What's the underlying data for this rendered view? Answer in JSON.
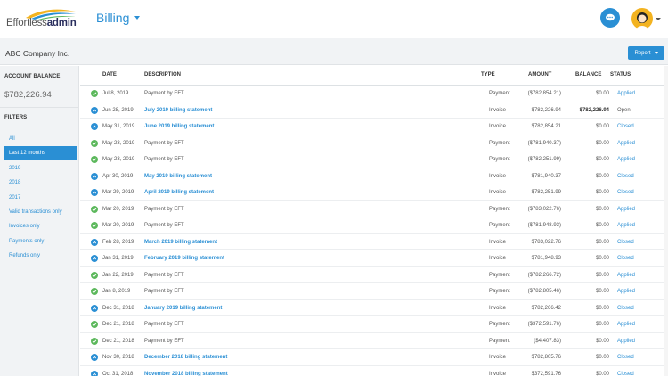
{
  "header": {
    "logo_light": "Effortless",
    "logo_bold": "admin",
    "app_name": "Billing"
  },
  "subheader": {
    "company": "ABC Company Inc.",
    "report_label": "Report"
  },
  "sidebar": {
    "balance_label": "ACCOUNT BALANCE",
    "balance_value": "$782,226.94",
    "filters_label": "FILTERS",
    "filters": [
      {
        "label": "All",
        "active": false
      },
      {
        "label": "Last 12 months",
        "active": true
      },
      {
        "label": "2019",
        "active": false
      },
      {
        "label": "2018",
        "active": false
      },
      {
        "label": "2017",
        "active": false
      },
      {
        "label": "Valid transactions only",
        "active": false
      },
      {
        "label": "Invoices only",
        "active": false
      },
      {
        "label": "Payments only",
        "active": false
      },
      {
        "label": "Refunds only",
        "active": false
      }
    ]
  },
  "table": {
    "columns": [
      "DATE",
      "DESCRIPTION",
      "TYPE",
      "AMOUNT",
      "BALANCE",
      "STATUS"
    ],
    "rows": [
      {
        "icon": "check-circle-icon",
        "date": "Jul 8, 2019",
        "description": "Payment by EFT",
        "link": false,
        "type": "Payment",
        "amount": "($782,854.21)",
        "balance": "$0.00",
        "balance_bold": false,
        "status": "Applied",
        "status_link": true
      },
      {
        "icon": "chevron-up-circle-icon",
        "date": "Jun 28, 2019",
        "description": "July 2019 billing statement",
        "link": true,
        "type": "Invoice",
        "amount": "$782,226.94",
        "balance": "$782,226.94",
        "balance_bold": true,
        "status": "Open",
        "status_link": false
      },
      {
        "icon": "chevron-up-circle-icon",
        "date": "May 31, 2019",
        "description": "June 2019 billing statement",
        "link": true,
        "type": "Invoice",
        "amount": "$782,854.21",
        "balance": "$0.00",
        "balance_bold": false,
        "status": "Closed",
        "status_link": true
      },
      {
        "icon": "check-circle-icon",
        "date": "May 23, 2019",
        "description": "Payment by EFT",
        "link": false,
        "type": "Payment",
        "amount": "($781,940.37)",
        "balance": "$0.00",
        "balance_bold": false,
        "status": "Applied",
        "status_link": true
      },
      {
        "icon": "check-circle-icon",
        "date": "May 23, 2019",
        "description": "Payment by EFT",
        "link": false,
        "type": "Payment",
        "amount": "($782,251.99)",
        "balance": "$0.00",
        "balance_bold": false,
        "status": "Applied",
        "status_link": true
      },
      {
        "icon": "chevron-up-circle-icon",
        "date": "Apr 30, 2019",
        "description": "May 2019 billing statement",
        "link": true,
        "type": "Invoice",
        "amount": "$781,940.37",
        "balance": "$0.00",
        "balance_bold": false,
        "status": "Closed",
        "status_link": true
      },
      {
        "icon": "chevron-up-circle-icon",
        "date": "Mar 29, 2019",
        "description": "April 2019 billing statement",
        "link": true,
        "type": "Invoice",
        "amount": "$782,251.99",
        "balance": "$0.00",
        "balance_bold": false,
        "status": "Closed",
        "status_link": true
      },
      {
        "icon": "check-circle-icon",
        "date": "Mar 20, 2019",
        "description": "Payment by EFT",
        "link": false,
        "type": "Payment",
        "amount": "($783,022.76)",
        "balance": "$0.00",
        "balance_bold": false,
        "status": "Applied",
        "status_link": true
      },
      {
        "icon": "check-circle-icon",
        "date": "Mar 20, 2019",
        "description": "Payment by EFT",
        "link": false,
        "type": "Payment",
        "amount": "($781,948.93)",
        "balance": "$0.00",
        "balance_bold": false,
        "status": "Applied",
        "status_link": true
      },
      {
        "icon": "chevron-up-circle-icon",
        "date": "Feb 28, 2019",
        "description": "March 2019 billing statement",
        "link": true,
        "type": "Invoice",
        "amount": "$783,022.76",
        "balance": "$0.00",
        "balance_bold": false,
        "status": "Closed",
        "status_link": true
      },
      {
        "icon": "chevron-up-circle-icon",
        "date": "Jan 31, 2019",
        "description": "February 2019 billing statement",
        "link": true,
        "type": "Invoice",
        "amount": "$781,948.93",
        "balance": "$0.00",
        "balance_bold": false,
        "status": "Closed",
        "status_link": true
      },
      {
        "icon": "check-circle-icon",
        "date": "Jan 22, 2019",
        "description": "Payment by EFT",
        "link": false,
        "type": "Payment",
        "amount": "($782,266.72)",
        "balance": "$0.00",
        "balance_bold": false,
        "status": "Applied",
        "status_link": true
      },
      {
        "icon": "check-circle-icon",
        "date": "Jan 8, 2019",
        "description": "Payment by EFT",
        "link": false,
        "type": "Payment",
        "amount": "($782,805.46)",
        "balance": "$0.00",
        "balance_bold": false,
        "status": "Applied",
        "status_link": true
      },
      {
        "icon": "chevron-up-circle-icon",
        "date": "Dec 31, 2018",
        "description": "January 2019 billing statement",
        "link": true,
        "type": "Invoice",
        "amount": "$782,266.42",
        "balance": "$0.00",
        "balance_bold": false,
        "status": "Closed",
        "status_link": true
      },
      {
        "icon": "check-circle-icon",
        "date": "Dec 21, 2018",
        "description": "Payment by EFT",
        "link": false,
        "type": "Payment",
        "amount": "($372,591.76)",
        "balance": "$0.00",
        "balance_bold": false,
        "status": "Applied",
        "status_link": true
      },
      {
        "icon": "check-circle-icon",
        "date": "Dec 21, 2018",
        "description": "Payment by EFT",
        "link": false,
        "type": "Payment",
        "amount": "($4,407.83)",
        "balance": "$0.00",
        "balance_bold": false,
        "status": "Applied",
        "status_link": true
      },
      {
        "icon": "chevron-up-circle-icon",
        "date": "Nov 30, 2018",
        "description": "December 2018 billing statement",
        "link": true,
        "type": "Invoice",
        "amount": "$782,805.76",
        "balance": "$0.00",
        "balance_bold": false,
        "status": "Closed",
        "status_link": true
      },
      {
        "icon": "chevron-up-circle-icon",
        "date": "Oct 31, 2018",
        "description": "November 2018 billing statement",
        "link": true,
        "type": "Invoice",
        "amount": "$372,591.76",
        "balance": "$0.00",
        "balance_bold": false,
        "status": "Closed",
        "status_link": true
      }
    ]
  },
  "colors": {
    "accent": "#2a8fd4",
    "success": "#5cb85c",
    "sidebar_bg": "#f1f3f5"
  }
}
